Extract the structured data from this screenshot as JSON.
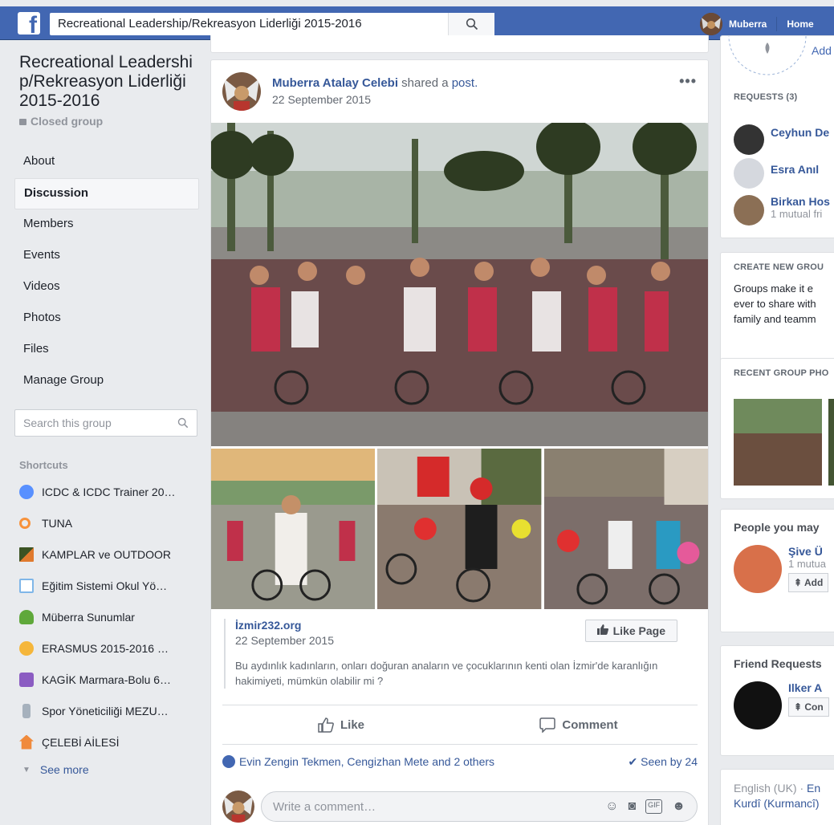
{
  "topbar": {
    "search_value": "Recreational Leadership/Rekreasyon Liderliği 2015-2016",
    "user_name": "Muberra",
    "home_label": "Home",
    "brand_color": "#4267b2"
  },
  "group": {
    "title": "Recreational Leadership/Rekreasyon Liderliği 2015-2016",
    "privacy": "Closed group",
    "nav": [
      "About",
      "Discussion",
      "Members",
      "Events",
      "Videos",
      "Photos",
      "Files",
      "Manage Group"
    ],
    "active_nav": "Discussion",
    "search_placeholder": "Search this group"
  },
  "shortcuts": {
    "heading": "Shortcuts",
    "items": [
      {
        "label": "ICDC & ICDC Trainer 20…",
        "icon": "group-icon",
        "color": "#5890ff"
      },
      {
        "label": "TUNA",
        "icon": "search-orange-icon",
        "color": "#f7923b"
      },
      {
        "label": "KAMPLAR ve OUTDOOR",
        "icon": "landscape-icon",
        "color": "#3b5323"
      },
      {
        "label": "Eğitim Sistemi Okul Yö…",
        "icon": "book-icon",
        "color": "#7fb6e8"
      },
      {
        "label": "Müberra Sunumlar",
        "icon": "tree-icon",
        "color": "#5fa83a"
      },
      {
        "label": "ERASMUS 2015-2016 …",
        "icon": "masks-icon",
        "color": "#f5b63b"
      },
      {
        "label": "KAGİK Marmara-Bolu 6…",
        "icon": "music-icon",
        "color": "#8b5cc2"
      },
      {
        "label": "Spor Yöneticiliği MEZU…",
        "icon": "flask-icon",
        "color": "#a6b1bd"
      },
      {
        "label": "ÇELEBİ AİLESİ",
        "icon": "house-icon",
        "color": "#f08a3c"
      }
    ],
    "see_more": "See more"
  },
  "post": {
    "author": "Muberra Atalay Celebi",
    "action": "shared a",
    "object": "post.",
    "date": "22 September 2015",
    "link_source": "İzmir232.org",
    "link_date": "22 September 2015",
    "link_text": "Bu aydınlık kadınların, onları doğuran anaların ve çocuklarının kenti olan İzmir'de karanlığın hakimiyeti, mümkün olabilir mi ?",
    "like_page_label": "Like Page",
    "like_label": "Like",
    "comment_label": "Comment",
    "likers": "Evin Zengin Tekmen, Cengizhan Mete and 2 others",
    "seen_by": "Seen by 24",
    "comment_placeholder": "Write a comment…"
  },
  "right": {
    "add_label": "Add",
    "requests_heading": "REQUESTS (3)",
    "requests": [
      {
        "name": "Ceyhun De",
        "sub": ""
      },
      {
        "name": "Esra Anıl",
        "sub": ""
      },
      {
        "name": "Birkan Hos",
        "sub": "1 mutual fri"
      }
    ],
    "create_heading": "CREATE NEW GROU",
    "create_text": [
      "Groups make it e",
      "ever to share with",
      "family and teamm"
    ],
    "photos_heading": "RECENT GROUP PHO",
    "people_heading": "People you may",
    "people": {
      "name": "Şive Ü",
      "sub": "1 mutua",
      "btn": "Add"
    },
    "friend_heading": "Friend Requests",
    "friend": {
      "name": "Ilker A",
      "btn": "Con"
    },
    "footer_line1": "English (UK) ·",
    "footer_link1": "En",
    "footer_line2": "Kurdî (Kurmancî)"
  }
}
